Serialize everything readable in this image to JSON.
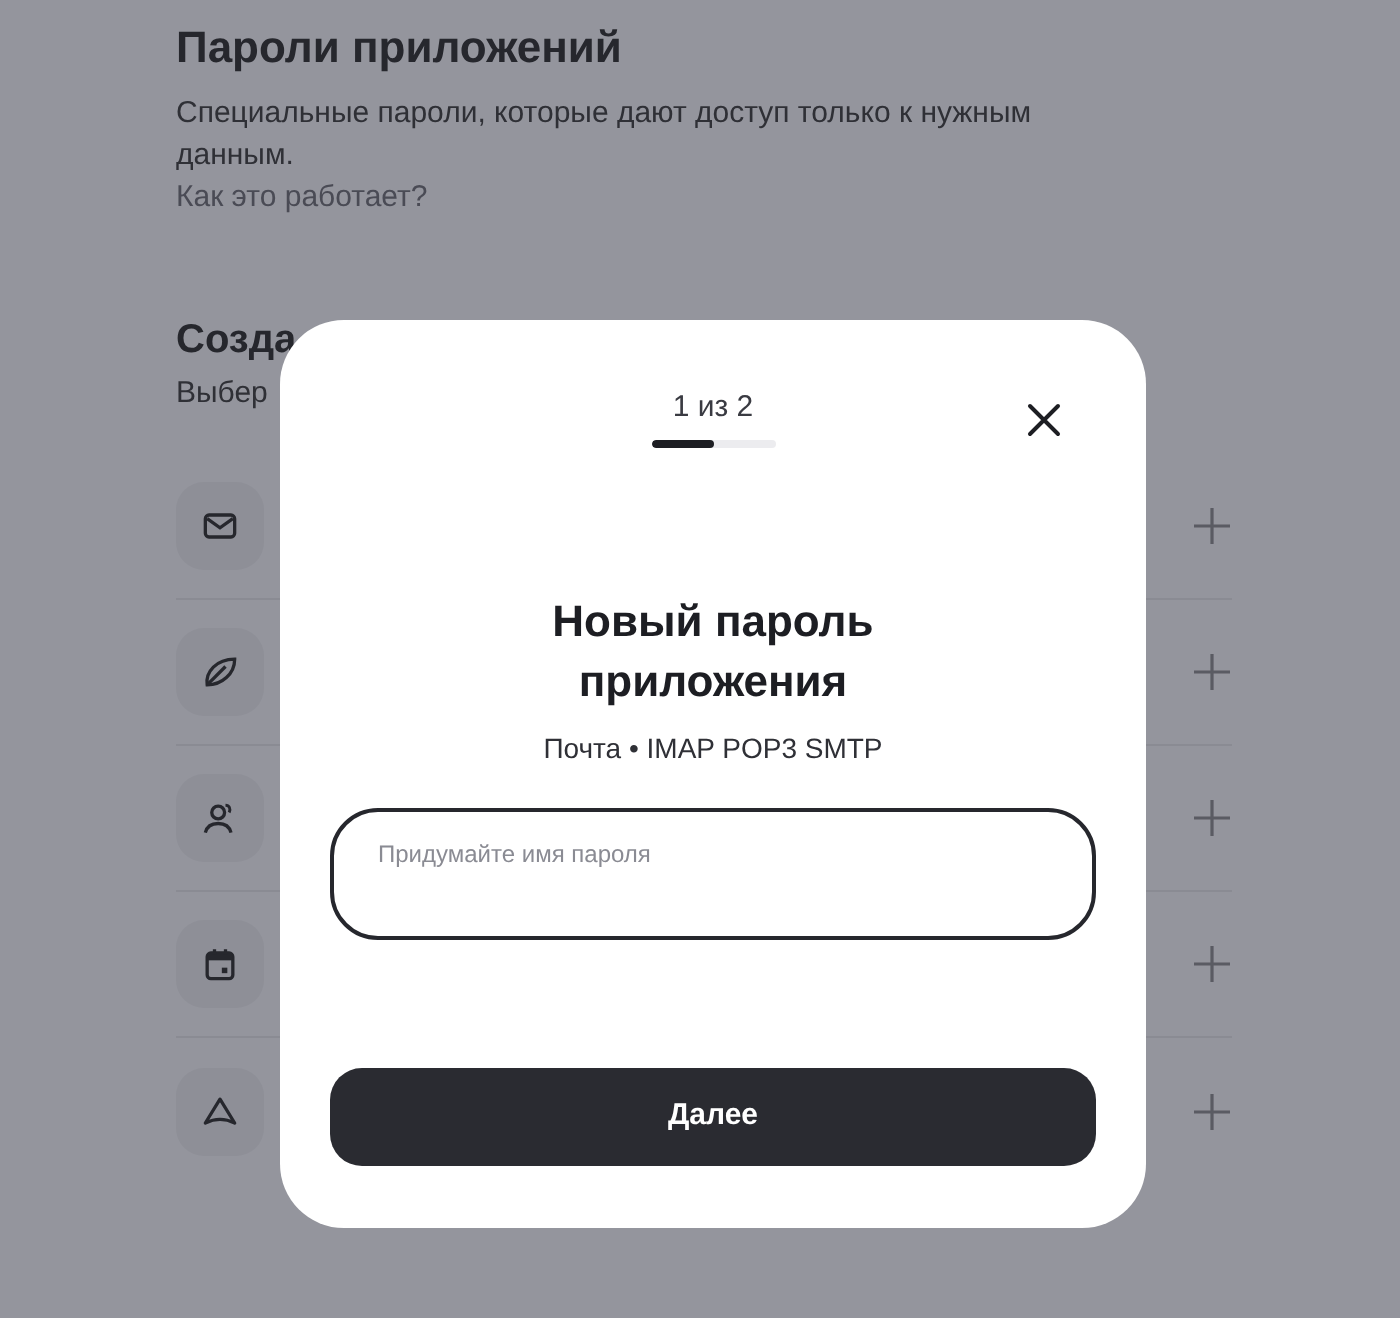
{
  "page": {
    "title": "Пароли приложений",
    "description": "Специальные пароли, которые дают доступ только к нужным данным.",
    "link": "Как это работает?",
    "section_title": "Созда",
    "section_subtitle": "Выбер",
    "rows": [
      {
        "kind": "mail"
      },
      {
        "kind": "leaf"
      },
      {
        "kind": "contacts"
      },
      {
        "kind": "calendar"
      },
      {
        "kind": "disk"
      }
    ]
  },
  "dialog": {
    "step": "1 из 2",
    "progress": {
      "level": 0.5
    },
    "title": "Новый пароль приложения",
    "subtitle": "Почта • IMAP POP3 SMTP",
    "field": {
      "placeholder": "Придумайте имя пароля"
    },
    "button": "Далее"
  }
}
